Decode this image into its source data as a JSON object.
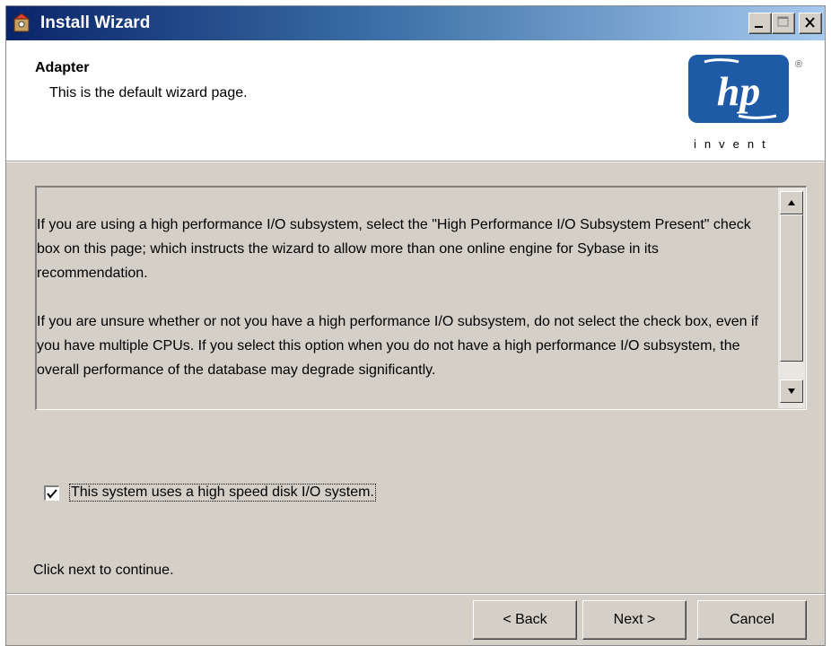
{
  "window": {
    "title": "Install Wizard"
  },
  "header": {
    "title": "Adapter",
    "subtitle": "This is the default wizard page.",
    "logo_text": "hp",
    "logo_registered": "®",
    "logo_tagline": "invent"
  },
  "info": {
    "paragraphs": [
      "If you are using a high performance I/O subsystem, select the \"High Performance I/O Subsystem Present\" check box on this page; which instructs the wizard to allow more than one online engine for Sybase in its recommendation.",
      "If you are unsure whether or not you have a high performance I/O subsystem, do not select the check box, even if you have multiple CPUs.  If you select this option when you do not have a high performance I/O subsystem, the overall performance of the database may degrade significantly."
    ]
  },
  "checkbox": {
    "label": "This system uses a high speed disk I/O system.",
    "checked": true
  },
  "footer": {
    "hint": "Click next to continue.",
    "back_label": "< Back",
    "next_label": "Next >",
    "cancel_label": "Cancel"
  },
  "colors": {
    "title_bar_start": "#0a246a",
    "title_bar_end": "#a6caf0",
    "hp_blue": "#1f5aa6",
    "dialog_face": "#d4d0c8"
  },
  "icons": [
    "app-icon",
    "minimize-icon",
    "maximize-icon",
    "close-icon",
    "scroll-up-icon",
    "scroll-down-icon",
    "checkmark-icon"
  ]
}
